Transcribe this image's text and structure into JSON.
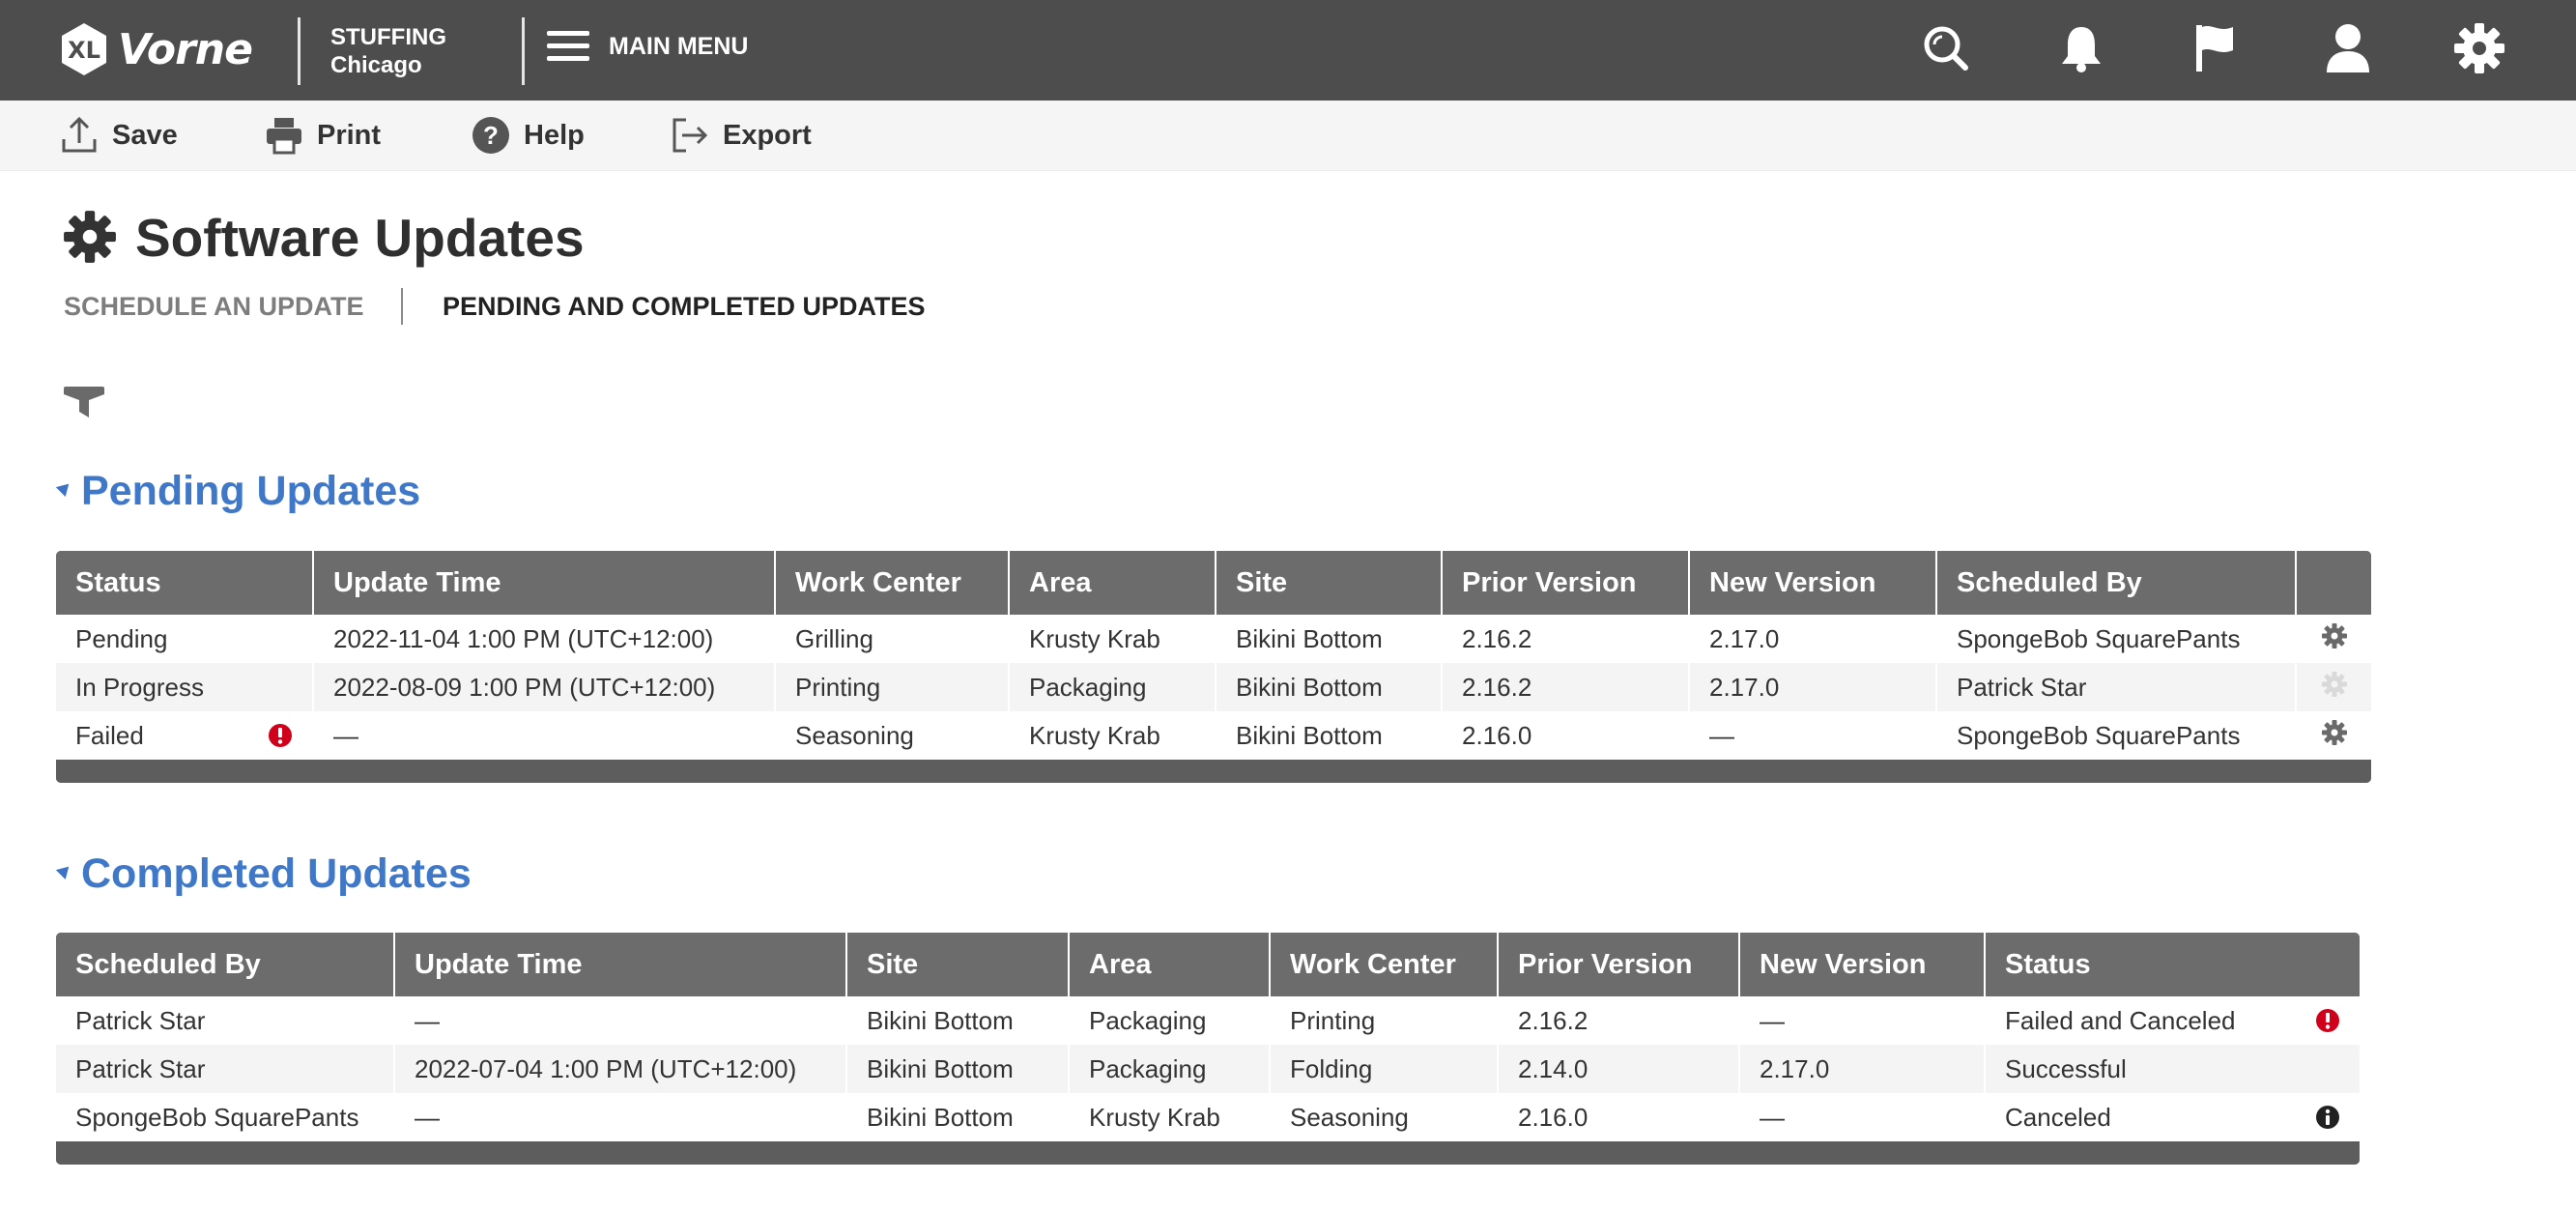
{
  "app": {
    "brand": "Vorne",
    "brand_badge": "XL",
    "plant_line1": "STUFFING",
    "plant_line2": "Chicago",
    "main_menu": "MAIN MENU",
    "colors": {
      "topbar": "#4d4d4d",
      "accent": "#3f78c8",
      "error": "#d0021b"
    },
    "top_icons": [
      "search-icon",
      "bell-icon",
      "flag-icon",
      "user-icon",
      "gear-icon"
    ]
  },
  "toolbar": {
    "save": "Save",
    "print": "Print",
    "help": "Help",
    "export": "Export"
  },
  "page": {
    "title": "Software Updates",
    "tabs": [
      {
        "label": "SCHEDULE AN UPDATE",
        "active": false
      },
      {
        "label": "PENDING AND COMPLETED UPDATES",
        "active": true
      }
    ]
  },
  "pending": {
    "title": "Pending Updates",
    "columns": [
      "Status",
      "Update Time",
      "Work Center",
      "Area",
      "Site",
      "Prior Version",
      "New Version",
      "Scheduled By",
      ""
    ],
    "rows": [
      {
        "status": "Pending",
        "status_icon": "",
        "update_time": "2022-11-04 1:00 PM (UTC+12:00)",
        "work_center": "Grilling",
        "area": "Krusty Krab",
        "site": "Bikini Bottom",
        "prior_version": "2.16.2",
        "new_version": "2.17.0",
        "scheduled_by": "SpongeBob SquarePants",
        "action_icon": "gear-icon",
        "action_enabled": true
      },
      {
        "status": "In Progress",
        "status_icon": "",
        "update_time": "2022-08-09 1:00 PM (UTC+12:00)",
        "work_center": "Printing",
        "area": "Packaging",
        "site": "Bikini Bottom",
        "prior_version": "2.16.2",
        "new_version": "2.17.0",
        "scheduled_by": "Patrick Star",
        "action_icon": "gear-icon",
        "action_enabled": false
      },
      {
        "status": "Failed",
        "status_icon": "error-icon",
        "update_time": "—",
        "work_center": "Seasoning",
        "area": "Krusty Krab",
        "site": "Bikini Bottom",
        "prior_version": "2.16.0",
        "new_version": "—",
        "scheduled_by": "SpongeBob SquarePants",
        "action_icon": "gear-icon",
        "action_enabled": true
      }
    ]
  },
  "completed": {
    "title": "Completed Updates",
    "columns": [
      "Scheduled By",
      "Update Time",
      "Site",
      "Area",
      "Work Center",
      "Prior Version",
      "New Version",
      "Status"
    ],
    "rows": [
      {
        "scheduled_by": "Patrick Star",
        "update_time": "—",
        "site": "Bikini Bottom",
        "area": "Packaging",
        "work_center": "Printing",
        "prior_version": "2.16.2",
        "new_version": "—",
        "status": "Failed and Canceled",
        "status_icon": "error-icon"
      },
      {
        "scheduled_by": "Patrick Star",
        "update_time": "2022-07-04 1:00 PM (UTC+12:00)",
        "site": "Bikini Bottom",
        "area": "Packaging",
        "work_center": "Folding",
        "prior_version": "2.14.0",
        "new_version": "2.17.0",
        "status": "Successful",
        "status_icon": ""
      },
      {
        "scheduled_by": "SpongeBob SquarePants",
        "update_time": "—",
        "site": "Bikini Bottom",
        "area": "Krusty Krab",
        "work_center": "Seasoning",
        "prior_version": "2.16.0",
        "new_version": "—",
        "status": "Canceled",
        "status_icon": "info-icon"
      }
    ]
  }
}
